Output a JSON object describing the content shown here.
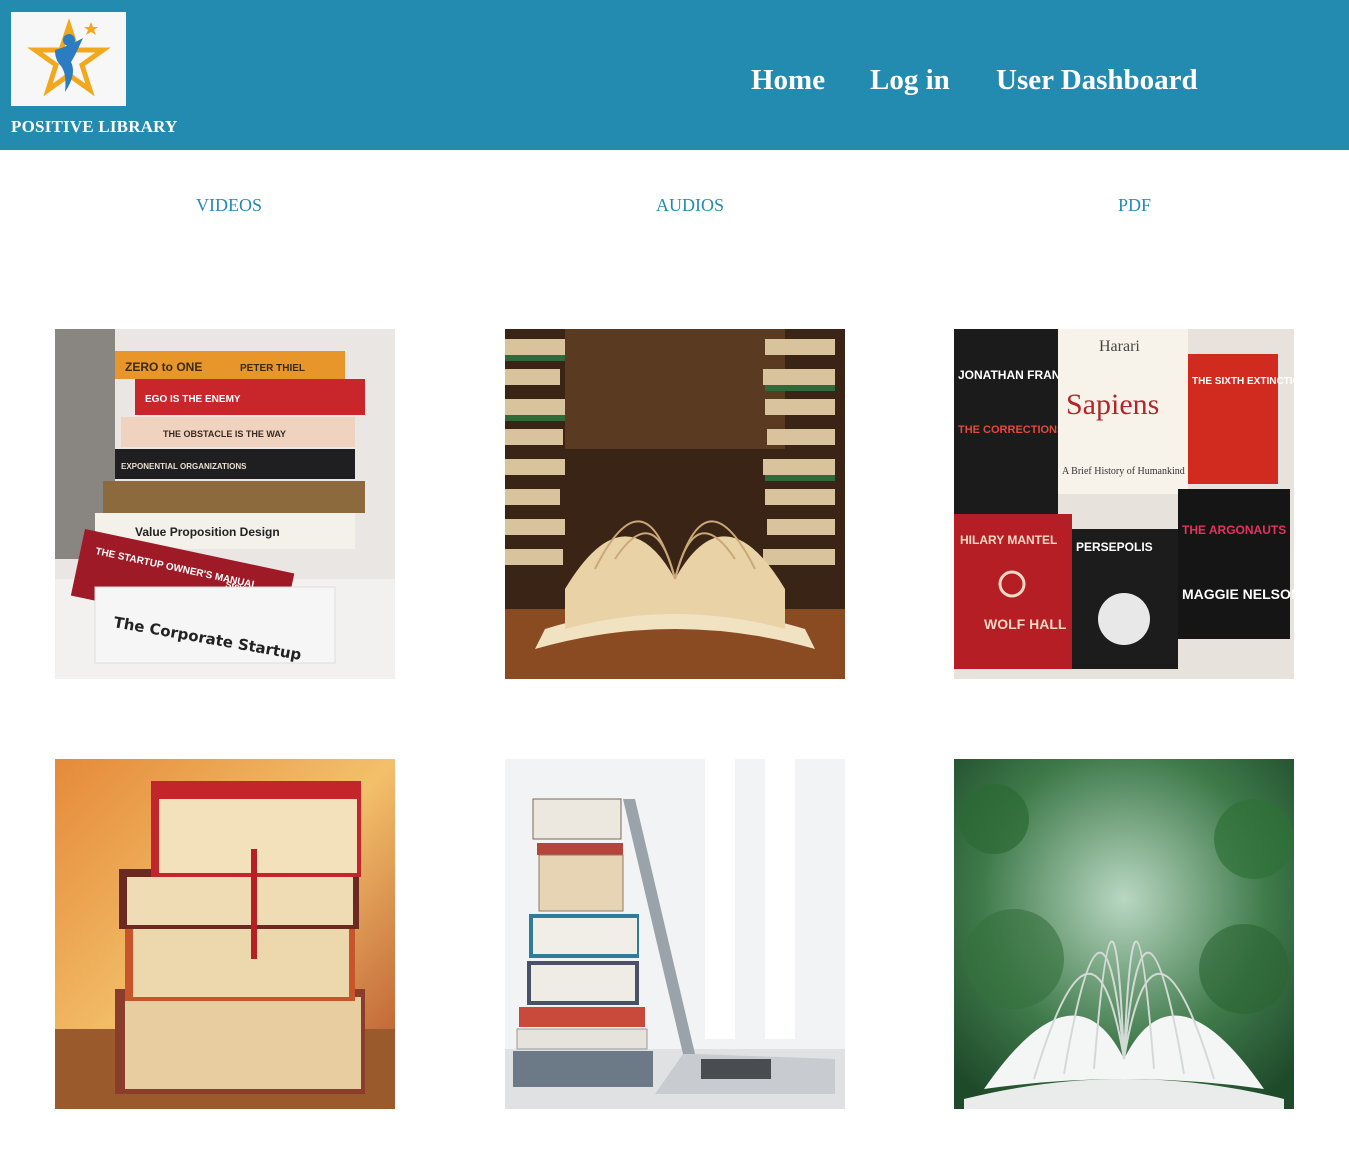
{
  "header": {
    "brand_name": "POSITIVE LIBRARY",
    "logo_icon": "star-person-logo-icon",
    "nav": [
      {
        "label": "Home"
      },
      {
        "label": "Log in"
      },
      {
        "label": "User Dashboard"
      }
    ]
  },
  "categories": [
    {
      "label": "VIDEOS"
    },
    {
      "label": "AUDIOS"
    },
    {
      "label": "PDF"
    }
  ],
  "gallery": {
    "images": [
      {
        "name": "book-stack-business-image",
        "spines": [
          "ZERO to ONE",
          "PETER THIEL",
          "EGO IS THE ENEMY",
          "THE OBSTACLE IS THE WAY",
          "EXPONENTIAL ORGANIZATIONS",
          "Value Proposition Design",
          "THE STARTUP OWNER'S MANUAL",
          "Steve Blank",
          "The Corporate Startup"
        ]
      },
      {
        "name": "open-book-library-image"
      },
      {
        "name": "book-covers-collage-image",
        "covers": [
          "JONATHAN FRANZEN",
          "THE CORRECTIONS",
          "Harari",
          "Sapiens",
          "A Brief History of Humankind",
          "THE SIXTH EXTINCTION",
          "HILARY MANTEL",
          "WOLF HALL",
          "PERSEPOLIS",
          "THE ARGONAUTS",
          "MAGGIE NELSON"
        ]
      },
      {
        "name": "hardcover-stack-image"
      },
      {
        "name": "books-and-laptop-image"
      },
      {
        "name": "open-book-greenery-image"
      }
    ]
  },
  "colors": {
    "header_bg": "#238bb0",
    "nav_text": "#ffffff",
    "category_link": "#238bb0"
  }
}
